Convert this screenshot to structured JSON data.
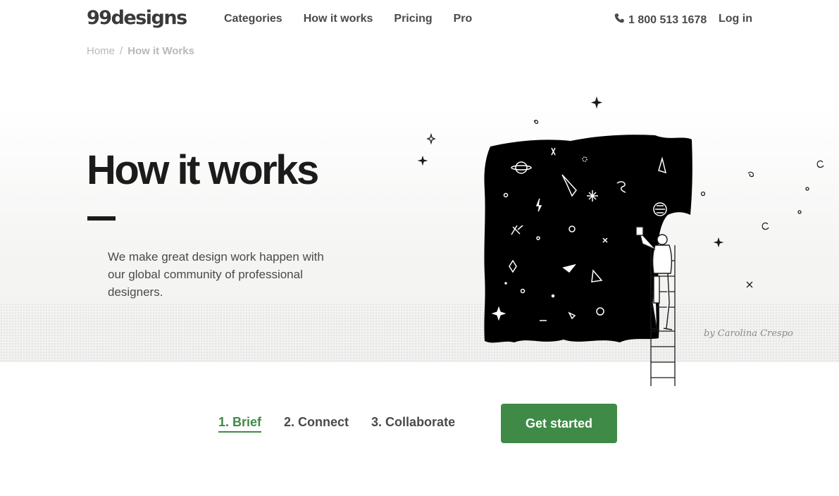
{
  "brand": {
    "logo_text": "99designs"
  },
  "nav": {
    "items": [
      "Categories",
      "How it works",
      "Pricing",
      "Pro"
    ]
  },
  "contact": {
    "phone": "1 800 513 1678"
  },
  "auth": {
    "login_label": "Log in"
  },
  "breadcrumb": {
    "home": "Home",
    "separator": "/",
    "current": "How it Works"
  },
  "hero": {
    "title": "How it works",
    "description": "We make great design work happen with our global community of professional designers.",
    "credit": "by Carolina Crespo"
  },
  "steps": {
    "items": [
      "1. Brief",
      "2. Connect",
      "3. Collaborate"
    ],
    "active_index": 0
  },
  "cta": {
    "label": "Get started"
  },
  "colors": {
    "accent": "#3f8a47",
    "text": "#4a4a4a",
    "title": "#1b1b1b",
    "muted": "#b8b8b8"
  }
}
